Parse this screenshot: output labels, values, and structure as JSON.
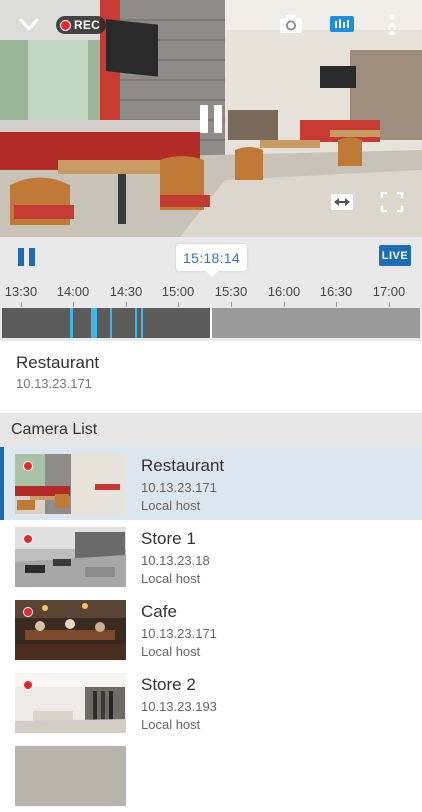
{
  "video": {
    "rec_label": "REC",
    "icons": {
      "back": "chevron-down-icon",
      "snapshot": "camera-icon",
      "audio": "audio-icon",
      "more": "more-vertical-icon",
      "pause": "pause-icon",
      "resize": "resize-horizontal-icon",
      "fullscreen": "fullscreen-icon"
    }
  },
  "timeline": {
    "current_time": "15:18:14",
    "live_label": "LIVE",
    "ticks": [
      "13:30",
      "14:00",
      "14:30",
      "15:00",
      "15:30",
      "16:00",
      "16:30",
      "17:00"
    ],
    "colors": {
      "recorded": "#5b5b5b",
      "event": "#3eb6ea",
      "empty": "#9a9a9a"
    }
  },
  "current_camera": {
    "name": "Restaurant",
    "ip": "10.13.23.171"
  },
  "camera_list": {
    "title": "Camera List",
    "items": [
      {
        "name": "Restaurant",
        "ip": "10.13.23.171",
        "host": "Local host",
        "selected": true,
        "recording": true
      },
      {
        "name": "Store 1",
        "ip": "10.13.23.18",
        "host": "Local host",
        "selected": false,
        "recording": true
      },
      {
        "name": "Cafe",
        "ip": "10.13.23.171",
        "host": "Local host",
        "selected": false,
        "recording": true
      },
      {
        "name": "Store 2",
        "ip": "10.13.23.193",
        "host": "Local host",
        "selected": false,
        "recording": true
      }
    ]
  },
  "theme": {
    "accent": "#1b6db5",
    "rec": "#e6262b",
    "selected_row": "#dce6ef"
  }
}
